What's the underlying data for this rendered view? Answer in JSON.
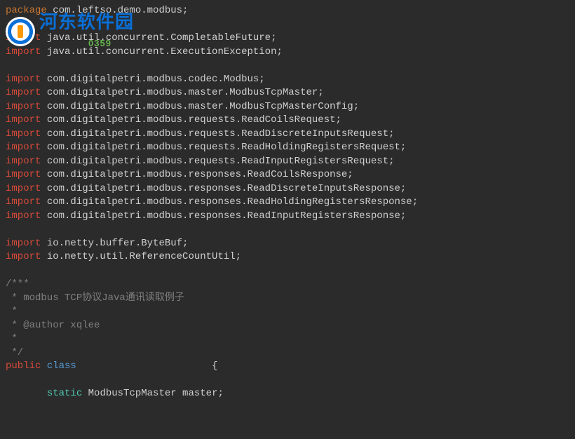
{
  "watermark": {
    "title": "河东软件园",
    "sub": "0359"
  },
  "code": {
    "lines": [
      {
        "tokens": [
          {
            "c": "kw-pkg",
            "t": "package"
          },
          {
            "c": "txt",
            "t": " com.leftso.demo.modbus;"
          }
        ]
      },
      {
        "tokens": []
      },
      {
        "tokens": [
          {
            "c": "kw-red",
            "t": "import"
          },
          {
            "c": "txt",
            "t": " java.util.concurrent.CompletableFuture;"
          }
        ]
      },
      {
        "tokens": [
          {
            "c": "kw-red",
            "t": "import"
          },
          {
            "c": "txt",
            "t": " java.util.concurrent.ExecutionException;"
          }
        ]
      },
      {
        "tokens": []
      },
      {
        "tokens": [
          {
            "c": "kw-red",
            "t": "import"
          },
          {
            "c": "txt",
            "t": " com.digitalpetri.modbus.codec.Modbus;"
          }
        ]
      },
      {
        "tokens": [
          {
            "c": "kw-red",
            "t": "import"
          },
          {
            "c": "txt",
            "t": " com.digitalpetri.modbus.master.ModbusTcpMaster;"
          }
        ]
      },
      {
        "tokens": [
          {
            "c": "kw-red",
            "t": "import"
          },
          {
            "c": "txt",
            "t": " com.digitalpetri.modbus.master.ModbusTcpMasterConfig;"
          }
        ]
      },
      {
        "tokens": [
          {
            "c": "kw-red",
            "t": "import"
          },
          {
            "c": "txt",
            "t": " com.digitalpetri.modbus.requests.ReadCoilsRequest;"
          }
        ]
      },
      {
        "tokens": [
          {
            "c": "kw-red",
            "t": "import"
          },
          {
            "c": "txt",
            "t": " com.digitalpetri.modbus.requests.ReadDiscreteInputsRequest;"
          }
        ]
      },
      {
        "tokens": [
          {
            "c": "kw-red",
            "t": "import"
          },
          {
            "c": "txt",
            "t": " com.digitalpetri.modbus.requests.ReadHoldingRegistersRequest;"
          }
        ]
      },
      {
        "tokens": [
          {
            "c": "kw-red",
            "t": "import"
          },
          {
            "c": "txt",
            "t": " com.digitalpetri.modbus.requests.ReadInputRegistersRequest;"
          }
        ]
      },
      {
        "tokens": [
          {
            "c": "kw-red",
            "t": "import"
          },
          {
            "c": "txt",
            "t": " com.digitalpetri.modbus.responses.ReadCoilsResponse;"
          }
        ]
      },
      {
        "tokens": [
          {
            "c": "kw-red",
            "t": "import"
          },
          {
            "c": "txt",
            "t": " com.digitalpetri.modbus.responses.ReadDiscreteInputsResponse;"
          }
        ]
      },
      {
        "tokens": [
          {
            "c": "kw-red",
            "t": "import"
          },
          {
            "c": "txt",
            "t": " com.digitalpetri.modbus.responses.ReadHoldingRegistersResponse;"
          }
        ]
      },
      {
        "tokens": [
          {
            "c": "kw-red",
            "t": "import"
          },
          {
            "c": "txt",
            "t": " com.digitalpetri.modbus.responses.ReadInputRegistersResponse;"
          }
        ]
      },
      {
        "tokens": []
      },
      {
        "tokens": [
          {
            "c": "kw-red",
            "t": "import"
          },
          {
            "c": "txt",
            "t": " io.netty.buffer.ByteBuf;"
          }
        ]
      },
      {
        "tokens": [
          {
            "c": "kw-red",
            "t": "import"
          },
          {
            "c": "txt",
            "t": " io.netty.util.ReferenceCountUtil;"
          }
        ]
      },
      {
        "tokens": []
      },
      {
        "tokens": [
          {
            "c": "comment",
            "t": "/***"
          }
        ]
      },
      {
        "tokens": [
          {
            "c": "comment",
            "t": " * modbus TCP协议Java通讯读取例子"
          }
        ]
      },
      {
        "tokens": [
          {
            "c": "comment",
            "t": " *"
          }
        ]
      },
      {
        "tokens": [
          {
            "c": "comment",
            "t": " * @author xqlee"
          }
        ]
      },
      {
        "tokens": [
          {
            "c": "comment",
            "t": " *"
          }
        ]
      },
      {
        "tokens": [
          {
            "c": "comment",
            "t": " */"
          }
        ]
      },
      {
        "tokens": [
          {
            "c": "kw-red",
            "t": "public"
          },
          {
            "c": "txt",
            "t": " "
          },
          {
            "c": "kw-blue",
            "t": "class"
          },
          {
            "c": "txt",
            "t": "                       "
          },
          {
            "c": "txt",
            "t": "{"
          }
        ]
      },
      {
        "tokens": []
      },
      {
        "tokens": [
          {
            "c": "txt",
            "t": "       "
          },
          {
            "c": "kw-cyan",
            "t": "static"
          },
          {
            "c": "txt",
            "t": " ModbusTcpMaster master;"
          }
        ]
      }
    ]
  }
}
